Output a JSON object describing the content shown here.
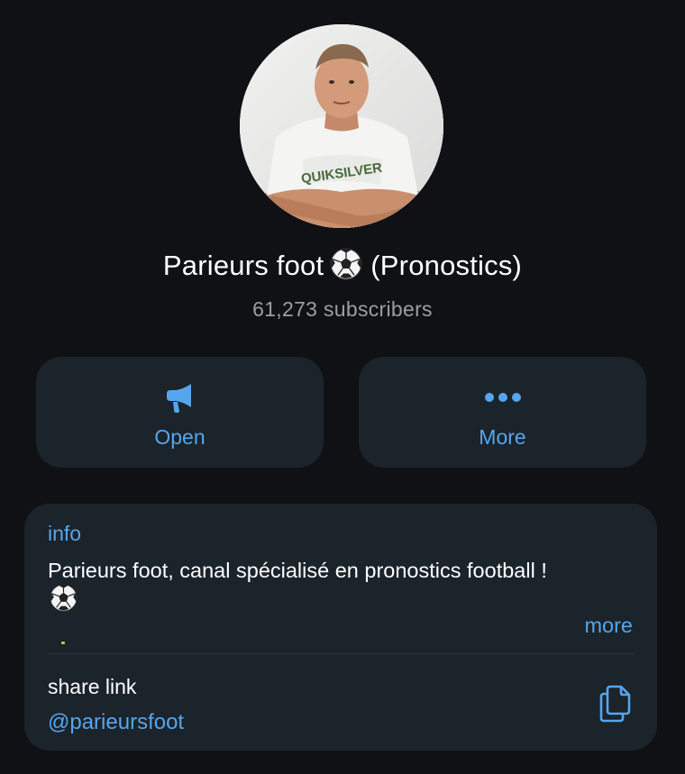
{
  "channel": {
    "name": "Parieurs foot",
    "suffix": "(Pronostics)",
    "subscribers": "61,273 subscribers",
    "emoji_icon": "soccer-ball-icon"
  },
  "actions": [
    {
      "label": "Open",
      "icon": "megaphone-icon"
    },
    {
      "label": "More",
      "icon": "ellipsis-icon"
    }
  ],
  "info": {
    "label": "info",
    "text": "Parieurs foot, canal spécialisé en pronostics football !",
    "more_label": "more"
  },
  "share": {
    "label": "share link",
    "handle": "@parieursfoot",
    "icon": "copy-icon"
  },
  "colors": {
    "background": "#0f1114",
    "card": "#1b232b",
    "accent": "#55a6ec",
    "secondary_text": "#9b9ea3"
  }
}
